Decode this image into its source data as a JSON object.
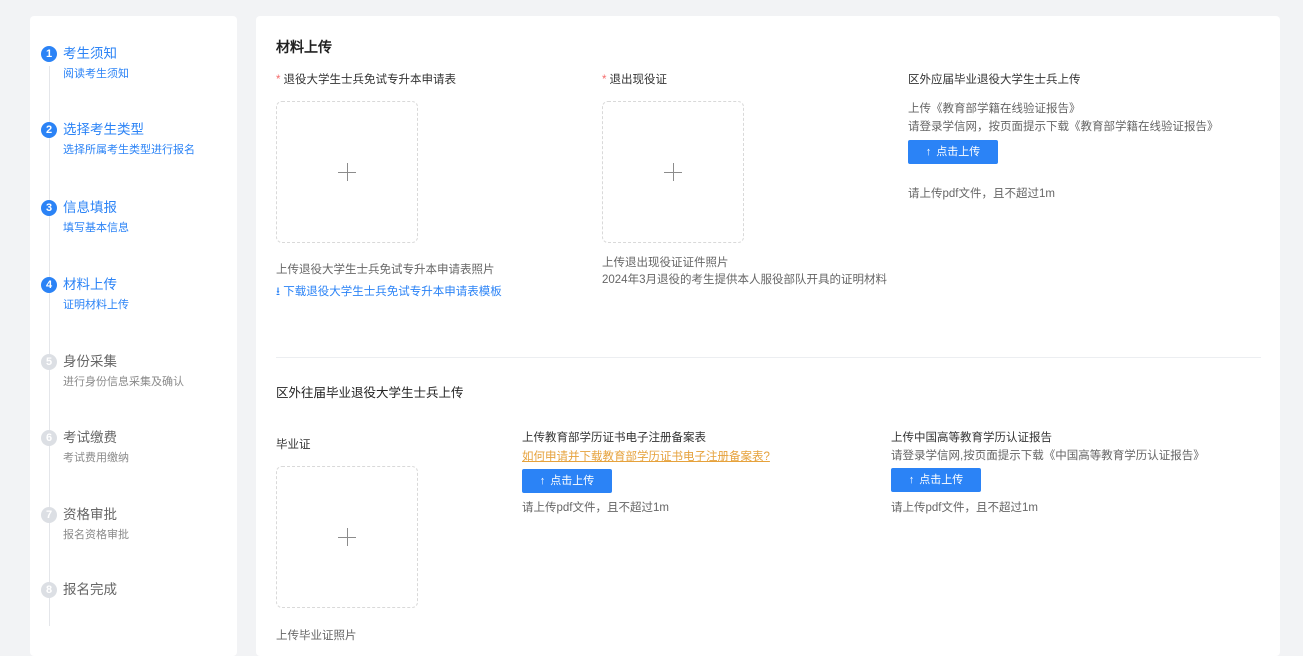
{
  "colors": {
    "accent": "#2b83f6",
    "required": "#f56c6c",
    "warning_link": "#e6a23c"
  },
  "steps": [
    {
      "num": "1",
      "title": "考生须知",
      "sub": "阅读考生须知",
      "state": "active"
    },
    {
      "num": "2",
      "title": "选择考生类型",
      "sub": "选择所属考生类型进行报名",
      "state": "active"
    },
    {
      "num": "3",
      "title": "信息填报",
      "sub": "填写基本信息",
      "state": "active"
    },
    {
      "num": "4",
      "title": "材料上传",
      "sub": "证明材料上传",
      "state": "active"
    },
    {
      "num": "5",
      "title": "身份采集",
      "sub": "进行身份信息采集及确认",
      "state": "inactive"
    },
    {
      "num": "6",
      "title": "考试缴费",
      "sub": "考试费用缴纳",
      "state": "inactive"
    },
    {
      "num": "7",
      "title": "资格审批",
      "sub": "报名资格审批",
      "state": "inactive"
    },
    {
      "num": "8",
      "title": "报名完成",
      "sub": "",
      "state": "inactive"
    }
  ],
  "main": {
    "title": "材料上传",
    "req_mark": "*",
    "col1": {
      "label": "退役大学生士兵免试专升本申请表",
      "hint": "上传退役大学生士兵免试专升本申请表照片",
      "download_icon": "download-icon",
      "download_label": "下载退役大学生士兵免试专升本申请表模板"
    },
    "col2": {
      "label": "退出现役证",
      "hint1": "上传退出现役证证件照片",
      "hint2": "2024年3月退役的考生提供本人服役部队开具的证明材料"
    },
    "col3": {
      "label": "区外应届毕业退役大学生士兵上传",
      "line1": "上传《教育部学籍在线验证报告》",
      "line2": "请登录学信网，按页面提示下载《教育部学籍在线验证报告》",
      "button": "点击上传",
      "note": "请上传pdf文件，且不超过1m"
    },
    "section2": {
      "title": "区外往届毕业退役大学生士兵上传",
      "diploma_label": "毕业证",
      "diploma_hint": "上传毕业证照片",
      "mid": {
        "title": "上传教育部学历证书电子注册备案表",
        "link": "如何申请并下载教育部学历证书电子注册备案表?",
        "button": "点击上传",
        "note": "请上传pdf文件，且不超过1m"
      },
      "right": {
        "title": "上传中国高等教育学历认证报告",
        "line": "请登录学信网,按页面提示下载《中国高等教育学历认证报告》",
        "button": "点击上传",
        "note": "请上传pdf文件，且不超过1m"
      }
    },
    "upload_arrow": "↑",
    "plus_icon": "plus-icon"
  }
}
